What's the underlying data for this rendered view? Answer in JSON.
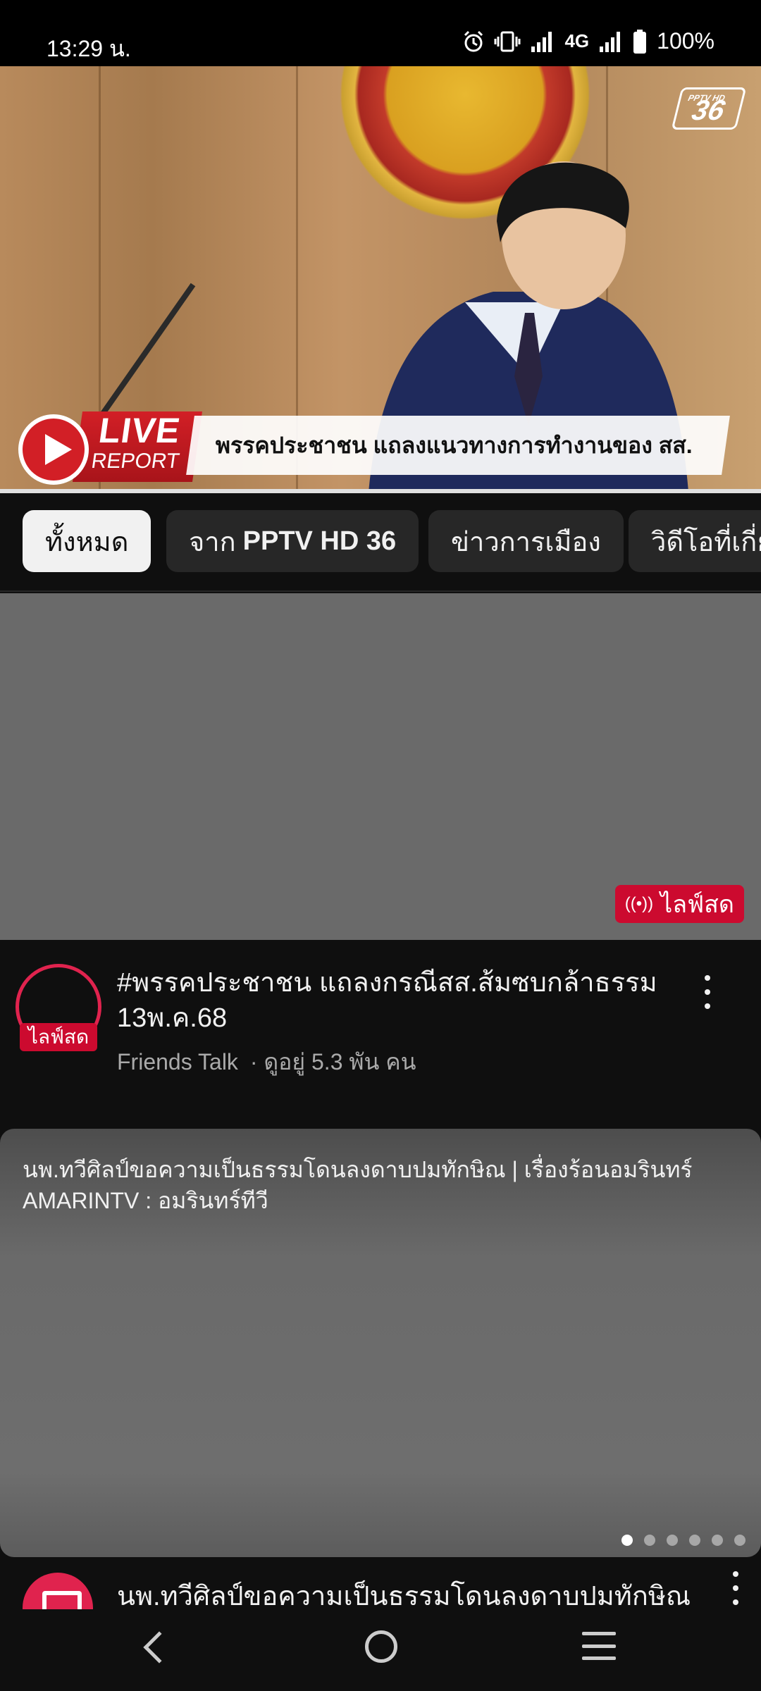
{
  "status_bar": {
    "time": "13:29 น.",
    "network": "4G",
    "battery": "100%",
    "icons": [
      "alarm-icon",
      "vibrate-icon",
      "signal-icon",
      "signal-icon",
      "battery-icon"
    ]
  },
  "player": {
    "channel_logo_top": "PPTV HD",
    "channel_logo_number": "36",
    "live_label": "LIVE",
    "report_label": "REPORT",
    "headline": "พรรคประชาชน แถลงแนวทางการทำงานของ สส.",
    "progress": 1.0
  },
  "chips": [
    {
      "label": "ทั้งหมด",
      "bold": "",
      "active": true
    },
    {
      "label": "จาก",
      "bold": "PPTV HD 36",
      "active": false
    },
    {
      "label": "ข่าวการเมือง",
      "bold": "",
      "active": false
    },
    {
      "label": "วิดีโอที่เกี่ย",
      "bold": "",
      "active": false
    }
  ],
  "video1": {
    "live_badge": "ไลฟ์สด",
    "avatar_tag": "ไลฟ์สด",
    "title": "#พรรคประชาชน แถลงกรณีสส.ส้มซบกล้าธรรม 13พ.ค.68",
    "channel": "Friends Talk",
    "watching": "· ดูอยู่ 5.3 พัน คน"
  },
  "video2": {
    "overlay_title": "นพ.ทวีศิลป์ขอความเป็นธรรมโดนลงดาบปมทักษิณ | เรื่องร้อนอมรินทร์ AMARINTV : อมรินทร์ทีวี",
    "pages": 6,
    "current_page": 1
  },
  "video3": {
    "title": "นพ.ทวีศิลป์ขอความเป็นธรรมโดนลงดาบปมทักษิณ"
  },
  "colors": {
    "background": "#0f0f0f",
    "chip_bg": "#272727",
    "chip_active_bg": "#f1f1f1",
    "live_red": "#cc0a2f",
    "thumbnail_grey": "#6a6a6a"
  }
}
